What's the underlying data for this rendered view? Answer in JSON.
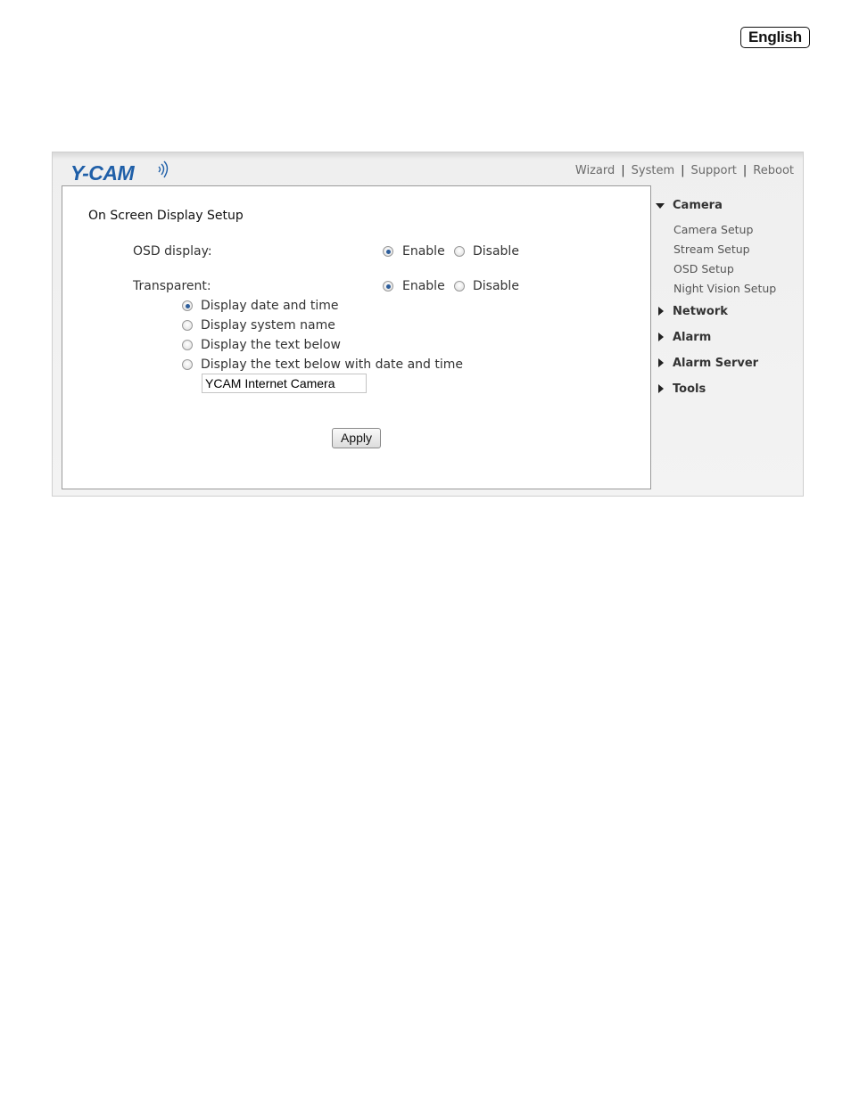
{
  "language": {
    "label": "English"
  },
  "brand": {
    "logo_text": "Y-CAM"
  },
  "top_nav": {
    "items": [
      "Wizard",
      "System",
      "Support",
      "Reboot"
    ]
  },
  "page": {
    "title": "On Screen Display Setup"
  },
  "osd_display": {
    "label": "OSD display:",
    "enable": "Enable",
    "disable": "Disable",
    "selected": "Enable"
  },
  "transparent": {
    "label": "Transparent:",
    "enable": "Enable",
    "disable": "Disable",
    "selected": "Enable"
  },
  "display_options": {
    "items": [
      "Display date and time",
      "Display system name",
      "Display the text below",
      "Display the text below with date and time"
    ],
    "selected_index": 0
  },
  "custom_text": {
    "value": "YCAM Internet Camera"
  },
  "apply": {
    "label": "Apply"
  },
  "sidebar": {
    "camera": {
      "label": "Camera",
      "items": [
        "Camera Setup",
        "Stream Setup",
        "OSD Setup",
        "Night Vision Setup"
      ]
    },
    "network": {
      "label": "Network"
    },
    "alarm": {
      "label": "Alarm"
    },
    "alarm_server": {
      "label": "Alarm Server"
    },
    "tools": {
      "label": "Tools"
    }
  },
  "colors": {
    "accent": "#2d5d9a",
    "logo": "#1f5fa8"
  },
  "icons": {
    "signal": "signal-waves-icon",
    "expanded": "triangle-down-icon",
    "collapsed": "triangle-right-icon"
  }
}
